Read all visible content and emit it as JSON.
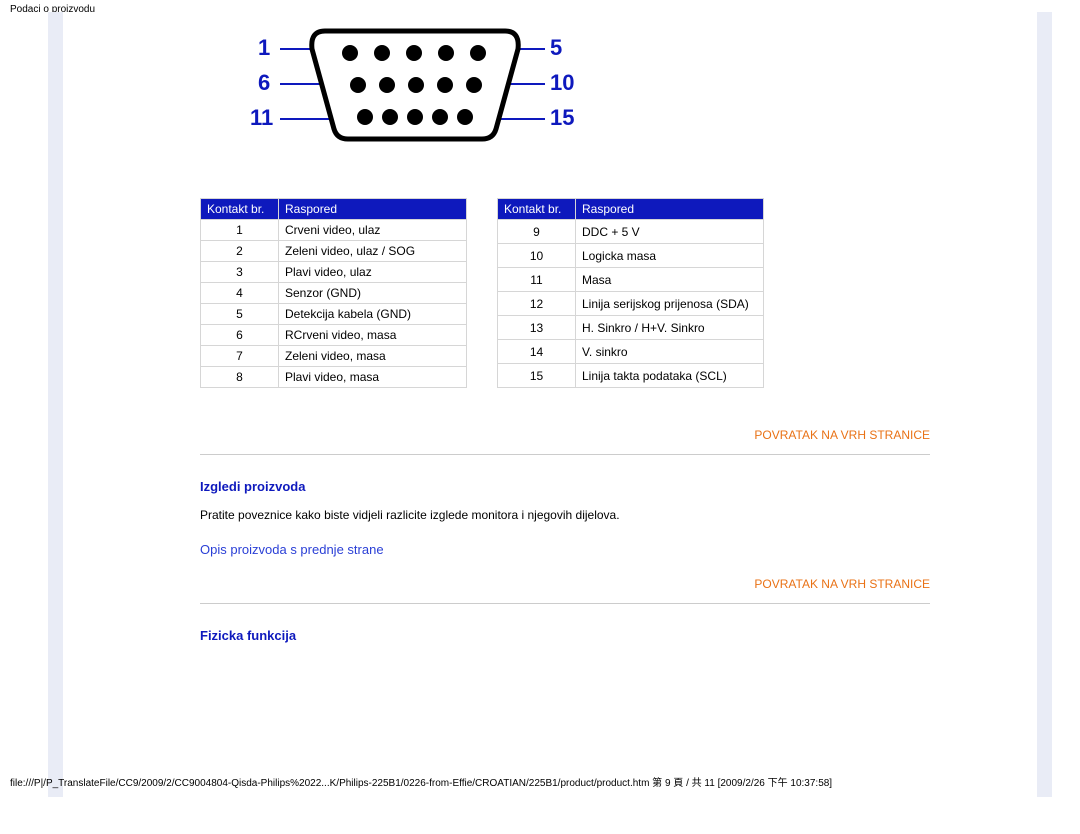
{
  "header": {
    "title": "Podaci o proizvodu"
  },
  "connector": {
    "labels_left": [
      "1",
      "6",
      "11"
    ],
    "labels_right": [
      "5",
      "10",
      "15"
    ]
  },
  "pin_table": {
    "headers": {
      "num": "Kontakt br.",
      "desc": "Raspored"
    },
    "left_rows": [
      {
        "n": "1",
        "d": "Crveni video, ulaz"
      },
      {
        "n": "2",
        "d": "Zeleni video, ulaz / SOG"
      },
      {
        "n": "3",
        "d": "Plavi video, ulaz"
      },
      {
        "n": "4",
        "d": "Senzor (GND)"
      },
      {
        "n": "5",
        "d": "Detekcija kabela (GND)"
      },
      {
        "n": "6",
        "d": "RCrveni video, masa"
      },
      {
        "n": "7",
        "d": "Zeleni video, masa"
      },
      {
        "n": "8",
        "d": "Plavi video, masa"
      }
    ],
    "right_rows": [
      {
        "n": "9",
        "d": "DDC + 5 V"
      },
      {
        "n": "10",
        "d": "Logicka masa"
      },
      {
        "n": "11",
        "d": "Masa"
      },
      {
        "n": "12",
        "d": "Linija serijskog prijenosa (SDA)"
      },
      {
        "n": "13",
        "d": "H. Sinkro / H+V. Sinkro"
      },
      {
        "n": "14",
        "d": "V. sinkro"
      },
      {
        "n": "15",
        "d": "Linija takta podataka (SCL)"
      }
    ]
  },
  "links": {
    "to_top": "POVRATAK NA VRH STRANICE",
    "front_view": "Opis proizvoda s prednje strane"
  },
  "sections": {
    "views": {
      "title": "Izgledi proizvoda",
      "body": "Pratite poveznice kako biste vidjeli razlicite izglede monitora i njegovih dijelova."
    },
    "physical": {
      "title": "Fizicka funkcija"
    }
  },
  "footer": {
    "path": "file:///P|/P_TranslateFile/CC9/2009/2/CC9004804-Qisda-Philips%2022...K/Philips-225B1/0226-from-Effie/CROATIAN/225B1/product/product.htm 第 9 頁 / 共 11  [2009/2/26 下午 10:37:58]"
  }
}
